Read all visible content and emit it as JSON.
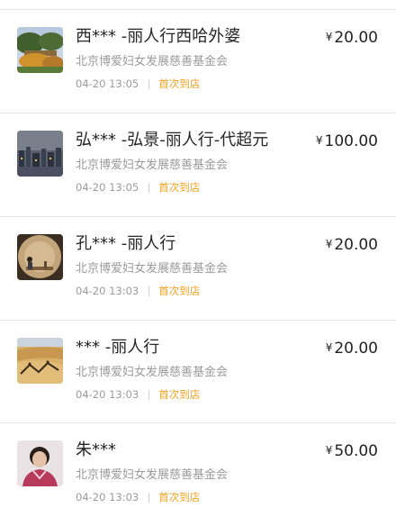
{
  "currency_symbol": "¥",
  "donations": [
    {
      "avatar": "garden-photo-icon",
      "name": "西*** -丽人行西哈外婆",
      "org": "北京博爱妇女发展慈善基金会",
      "time": "04-20 13:05",
      "tag": "首次到店",
      "amount": "20.00"
    },
    {
      "avatar": "city-skyline-photo-icon",
      "name": "弘*** -弘景-丽人行-代超元",
      "org": "北京博爱妇女发展慈善基金会",
      "time": "04-20 13:05",
      "tag": "首次到店",
      "amount": "100.00"
    },
    {
      "avatar": "indoor-figure-photo-icon",
      "name": "孔*** -丽人行",
      "org": "北京博爱妇女发展慈善基金会",
      "time": "04-20 13:03",
      "tag": "首次到店",
      "amount": "20.00"
    },
    {
      "avatar": "desert-caravan-photo-icon",
      "name": "*** -丽人行",
      "org": "北京博爱妇女发展慈善基金会",
      "time": "04-20 13:03",
      "tag": "首次到店",
      "amount": "20.00"
    },
    {
      "avatar": "person-portrait-icon",
      "name": "朱***",
      "org": "北京博爱妇女发展慈善基金会",
      "time": "04-20 13:03",
      "tag": "首次到店",
      "amount": "50.00"
    }
  ]
}
